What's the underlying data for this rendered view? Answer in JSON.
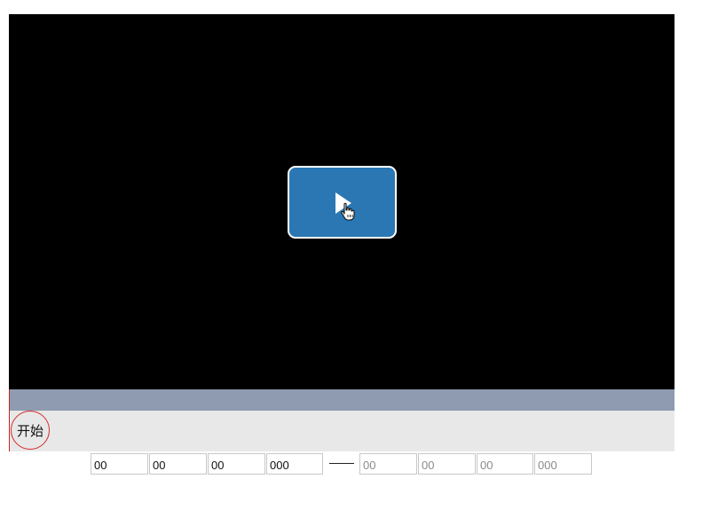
{
  "player": {
    "play_icon": "play-icon",
    "cursor_icon": "hand-pointer-icon",
    "accent_color": "#2a77b3",
    "timeline_color": "#8e9bb0"
  },
  "controls": {
    "start_label": "开始",
    "start_border_color": "#d42a2a"
  },
  "time_range": {
    "start": {
      "hours": "00",
      "minutes": "00",
      "seconds": "00",
      "milliseconds": "000"
    },
    "end_placeholder": {
      "hours": "00",
      "minutes": "00",
      "seconds": "00",
      "milliseconds": "000"
    }
  }
}
